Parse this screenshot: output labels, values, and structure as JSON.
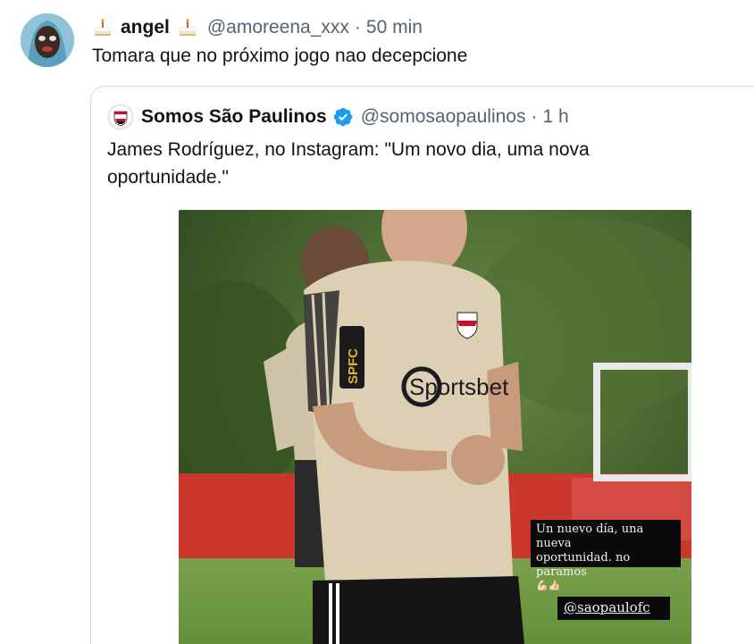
{
  "tweet": {
    "display_name": "angel",
    "name_emoji": "cake-icon",
    "handle": "@amoreena_xxx",
    "separator": "·",
    "time": "50 min",
    "text": "Tomara que no próximo jogo nao decepcione"
  },
  "quoted_tweet": {
    "display_name": "Somos São Paulinos",
    "verified": true,
    "handle": "@somosaopaulinos",
    "separator": "·",
    "time": "1 h",
    "text": "James Rodríguez, no Instagram: \"Um novo dia, uma nova oportunidade.\"",
    "media": {
      "caption_line1": "Un nuevo día, una nueva",
      "caption_line2": "oportunidad. no paramos",
      "caption_emoji": "💪🏻👍🏻",
      "mention": "@saopaulofc",
      "shirt_sponsor": "Sportsbet",
      "sleeve_text": "SPFC"
    }
  },
  "colors": {
    "text_primary": "#0f1419",
    "text_secondary": "#536471",
    "verified_blue": "#1d9bf0",
    "card_border": "#cfd9de"
  }
}
